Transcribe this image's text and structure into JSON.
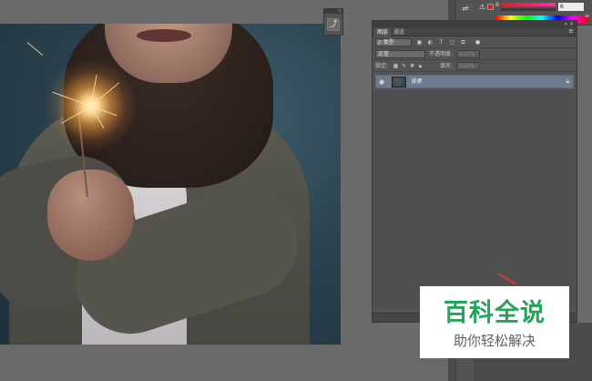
{
  "canvas_panel": {
    "icon": "history-brush-icon",
    "collapse_glyph": "«"
  },
  "right_dock": {
    "tool_icon": "adjustments-icon"
  },
  "color_panel": {
    "warning_glyph": "⚠",
    "channel_label": "B",
    "value": "6",
    "swatch_color": "#cc2727",
    "menu_glyph": "≡"
  },
  "layers_panel": {
    "topbar_controls": "« ×",
    "tabs": [
      {
        "label": "图层",
        "active": true
      },
      {
        "label": "通道",
        "active": false
      }
    ],
    "menu_glyph": "≡",
    "filter": {
      "kind_value": "ρ 类型",
      "icons": [
        "pixel-filter-icon",
        "adjustment-filter-icon",
        "type-filter-icon",
        "shape-filter-icon",
        "smart-object-filter-icon"
      ]
    },
    "blend": {
      "mode": "正常",
      "opacity_label": "不透明度:",
      "opacity_value": "100%"
    },
    "lock": {
      "label": "锁定:",
      "fill_label": "填充:",
      "fill_value": "100%"
    },
    "layers": [
      {
        "name": "背景",
        "visible": true,
        "locked": true
      }
    ]
  },
  "watermark": {
    "title": "百科全说",
    "subtitle": "助你轻松解决"
  },
  "colors": {
    "app_bg": "#6a6a6a",
    "panel_bg": "#535353",
    "layer_selected": "#6e7b8d",
    "watermark_green": "#25a35a",
    "annotation_red": "#dd3333"
  }
}
